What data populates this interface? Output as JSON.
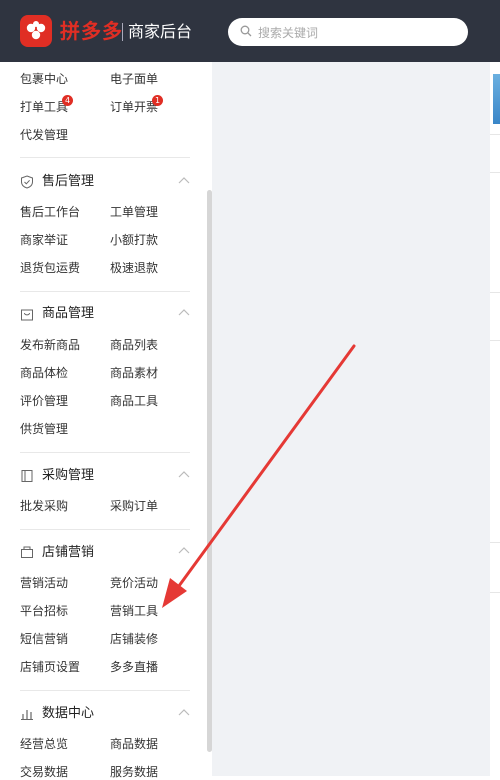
{
  "header": {
    "logo_text": "拼多多",
    "subtitle": "商家后台",
    "search_placeholder": "搜索关键词"
  },
  "sidebar": {
    "top_items": [
      {
        "label": "包裹中心"
      },
      {
        "label": "电子面单"
      },
      {
        "label": "打单工具",
        "badge": "4"
      },
      {
        "label": "订单开票",
        "badge": "1"
      },
      {
        "label": "代发管理"
      }
    ],
    "sections": [
      {
        "title": "售后管理",
        "icon": "shield-icon",
        "items": [
          "售后工作台",
          "工单管理",
          "商家举证",
          "小额打款",
          "退货包运费",
          "极速退款"
        ]
      },
      {
        "title": "商品管理",
        "icon": "bag-icon",
        "items": [
          "发布新商品",
          "商品列表",
          "商品体检",
          "商品素材",
          "评价管理",
          "商品工具",
          "供货管理"
        ]
      },
      {
        "title": "采购管理",
        "icon": "clipboard-icon",
        "items": [
          "批发采购",
          "采购订单"
        ]
      },
      {
        "title": "店铺营销",
        "icon": "shop-icon",
        "items": [
          "营销活动",
          "竞价活动",
          "平台招标",
          "营销工具",
          "短信营销",
          "店铺装修",
          "店铺页设置",
          "多多直播"
        ]
      },
      {
        "title": "数据中心",
        "icon": "bar-chart-icon",
        "items": [
          "经营总览",
          "商品数据",
          "交易数据",
          "服务数据"
        ]
      }
    ]
  },
  "colors": {
    "brand": "#e02e24",
    "header_bg": "#2f3440",
    "content_bg": "#f0f2f5",
    "annotation_arrow": "#e53935"
  }
}
